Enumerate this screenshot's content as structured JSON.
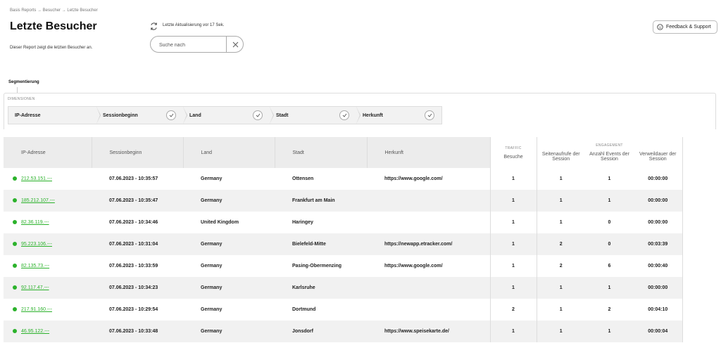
{
  "breadcrumb": "Basis Reports → Besucher → Letzte Besucher",
  "title": "Letzte Besucher",
  "description": "Dieser Report zeigt die letzten Besucher an.",
  "refresh": {
    "icon": "refresh-icon",
    "text": "Letzte Aktualisierung vor 17 Sek."
  },
  "search": {
    "placeholder": "Suche nach",
    "clear_icon": "close-icon"
  },
  "feedback": {
    "icon": "smiley-icon",
    "label": "Feedback & Support"
  },
  "segmentation": {
    "label": "Segmentierung",
    "dimensions_label": "DIMENSIONEN",
    "chips": [
      "IP-Adresse",
      "Sessionbeginn",
      "Land",
      "Stadt",
      "Herkunft"
    ]
  },
  "table": {
    "headers": {
      "ip": "IP-Adresse",
      "start": "Sessionbeginn",
      "land": "Land",
      "stadt": "Stadt",
      "herkunft": "Herkunft",
      "traffic_group": "TRAFFIC",
      "besuche": "Besuche",
      "engagement_group": "ENGAGEMENT",
      "seitenaufrufe": "Seitenaufrufe der Session",
      "events": "Anzahl Events der Session",
      "verweildauer": "Verweildauer der Session"
    },
    "rows": [
      {
        "ip": "212.53.151.---",
        "start": "07.06.2023 - 10:35:57",
        "land": "Germany",
        "stadt": "Ottensen",
        "herkunft": "https://www.google.com/",
        "besuche": "1",
        "seitenaufrufe": "1",
        "events": "1",
        "verweildauer": "00:00:00"
      },
      {
        "ip": "185.212.107.---",
        "start": "07.06.2023 - 10:35:47",
        "land": "Germany",
        "stadt": "Frankfurt am Main",
        "herkunft": "",
        "besuche": "1",
        "seitenaufrufe": "1",
        "events": "1",
        "verweildauer": "00:00:00"
      },
      {
        "ip": "82.36.119.---",
        "start": "07.06.2023 - 10:34:46",
        "land": "United Kingdom",
        "stadt": "Haringey",
        "herkunft": "",
        "besuche": "1",
        "seitenaufrufe": "1",
        "events": "0",
        "verweildauer": "00:00:00"
      },
      {
        "ip": "95.223.106.---",
        "start": "07.06.2023 - 10:31:04",
        "land": "Germany",
        "stadt": "Bielefeld-Mitte",
        "herkunft": "https://newapp.etracker.com/",
        "besuche": "1",
        "seitenaufrufe": "2",
        "events": "0",
        "verweildauer": "00:03:39"
      },
      {
        "ip": "82.135.73.---",
        "start": "07.06.2023 - 10:33:59",
        "land": "Germany",
        "stadt": "Pasing-Obermenzing",
        "herkunft": "https://www.google.com/",
        "besuche": "1",
        "seitenaufrufe": "2",
        "events": "6",
        "verweildauer": "00:00:40"
      },
      {
        "ip": "92.117.47.---",
        "start": "07.06.2023 - 10:34:23",
        "land": "Germany",
        "stadt": "Karlsruhe",
        "herkunft": "",
        "besuche": "1",
        "seitenaufrufe": "1",
        "events": "1",
        "verweildauer": "00:00:00"
      },
      {
        "ip": "217.91.160.---",
        "start": "07.06.2023 - 10:29:54",
        "land": "Germany",
        "stadt": "Dortmund",
        "herkunft": "",
        "besuche": "2",
        "seitenaufrufe": "1",
        "events": "2",
        "verweildauer": "00:04:10"
      },
      {
        "ip": "46.95.122.---",
        "start": "07.06.2023 - 10:33:48",
        "land": "Germany",
        "stadt": "Jonsdorf",
        "herkunft": "https://www.speisekarte.de/",
        "besuche": "1",
        "seitenaufrufe": "1",
        "events": "1",
        "verweildauer": "00:00:04"
      }
    ]
  },
  "colors": {
    "accent": "#2bb22b",
    "header_bg": "#ececec",
    "row_alt": "#f1f1f1"
  }
}
